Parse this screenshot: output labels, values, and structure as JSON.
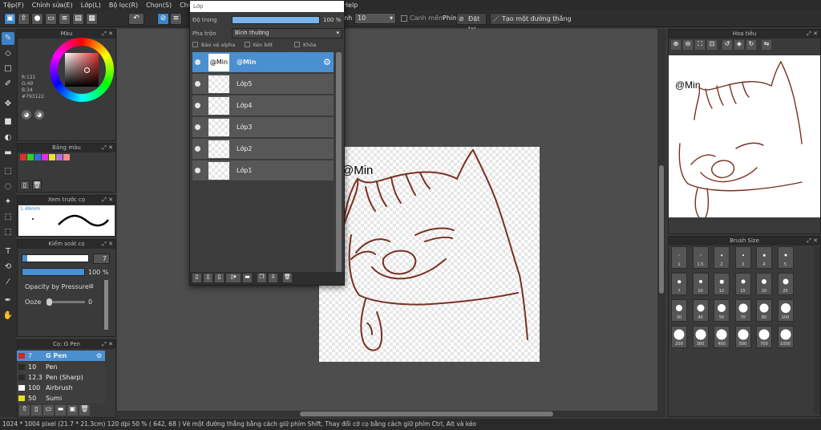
{
  "menu": [
    "Tệp(F)",
    "Chỉnh sửa(E)",
    "Lớp(L)",
    "Bộ lọc(R)",
    "Chọn(S)",
    "Chụp(N)",
    "Help"
  ],
  "toolbar": {
    "pixel_value": "10",
    "antialias_label": "Canh mềm",
    "key_label": "Phím",
    "reset_label": "Đặt lại",
    "straight_line_label": "Tạo một đường thẳng",
    "size_suffix": "ình"
  },
  "color_panel": {
    "title": "Màu",
    "r": "R:121",
    "g": "G:49",
    "b": "B:34",
    "hex": "#793122",
    "accent": "#793122"
  },
  "swatch_panel": {
    "title": "Bảng màu",
    "colors": [
      "#e52b2b",
      "#2bd32b",
      "#2b6ee5",
      "#e52be5",
      "#e5e52b",
      "#b36fe0",
      "#ff8a8a"
    ]
  },
  "brush_preview": {
    "title": "Xem trước cọ",
    "size": "1.49mm"
  },
  "brush_control": {
    "title": "Kiểm soát cọ",
    "size_value": "7",
    "opacity_value": "100 %",
    "opacity_pressure_label": "Opacity by Pressure",
    "ooze_label": "Ooze",
    "ooze_value": "0"
  },
  "brush_list": {
    "title": "Cọ: G Pen",
    "items": [
      {
        "num": "7",
        "name": "G Pen",
        "color": "#d42424"
      },
      {
        "num": "10",
        "name": "Pen",
        "color": "#2a2a2a"
      },
      {
        "num": "12.3",
        "name": "Pen (Sharp)",
        "color": "#2a2a2a"
      },
      {
        "num": "100",
        "name": "Airbrush",
        "color": "#ffffff"
      },
      {
        "num": "50",
        "name": "Sumi",
        "color": "#e8e020"
      }
    ]
  },
  "layer_panel": {
    "title": "Lớp",
    "opacity_label": "Độ trong",
    "opacity_value": "100 %",
    "blend_label": "Pha trộn",
    "blend_value": "Bình thường",
    "protect_alpha": "Bảo vệ alpha",
    "clipping": "Xén bớt",
    "lock": "Khóa",
    "layers": [
      "@Min",
      "Lớp5",
      "Lớp4",
      "Lớp3",
      "Lớp2",
      "Lớp1"
    ]
  },
  "navigator": {
    "title": "Hoa tiêu"
  },
  "brush_size": {
    "title": "Brush Size",
    "sizes": [
      "1",
      "1.5",
      "2",
      "3",
      "4",
      "5",
      "7",
      "10",
      "12",
      "15",
      "20",
      "25",
      "30",
      "40",
      "50",
      "70",
      "80",
      "100",
      "200",
      "300",
      "400",
      "500",
      "700",
      "1000"
    ]
  },
  "canvas": {
    "text": "@Min",
    "stroke_color": "#793122"
  },
  "status": {
    "text": "1024 * 1004 pixel   (21.7 * 21.3cm)   120 dpi   50 %   ( 642, 68 )   Vẽ một đường thẳng bằng cách giữ phím Shift, Thay đổi cỡ cọ bằng cách giữ phím Ctrl, Alt và kéo"
  }
}
